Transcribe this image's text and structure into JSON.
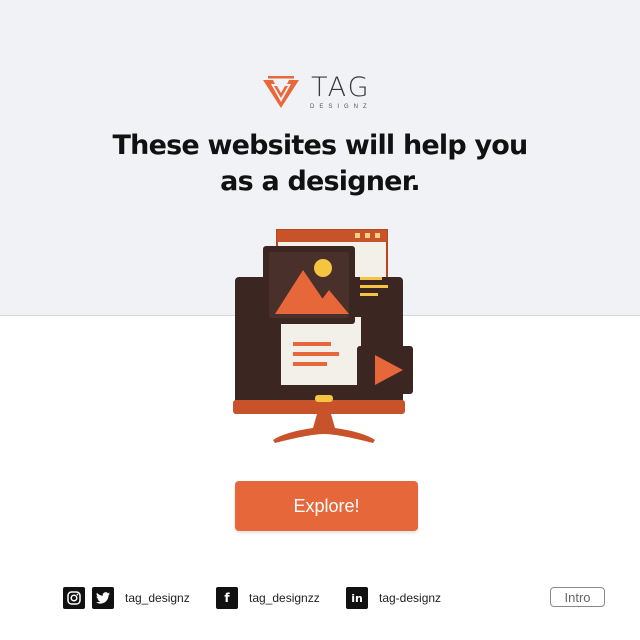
{
  "brand": {
    "name": "TAG",
    "tagline": "DESIGNZ"
  },
  "headline": {
    "line1": "These websites will help you",
    "line2": "as a designer."
  },
  "cta": {
    "label": "Explore!"
  },
  "social": {
    "instagram_twitter_handle": "tag_designz",
    "facebook_handle": "tag_designzz",
    "linkedin_handle": "tag-designz",
    "icons": [
      "instagram-icon",
      "twitter-icon",
      "facebook-icon",
      "linkedin-icon"
    ]
  },
  "page_tag": "Intro",
  "colors": {
    "accent": "#e5673a",
    "dark": "#3b2622",
    "top_background": "#f1f2f6",
    "text": "#111111"
  },
  "illustration": {
    "icon": "monitor-with-image-and-video-icon"
  }
}
